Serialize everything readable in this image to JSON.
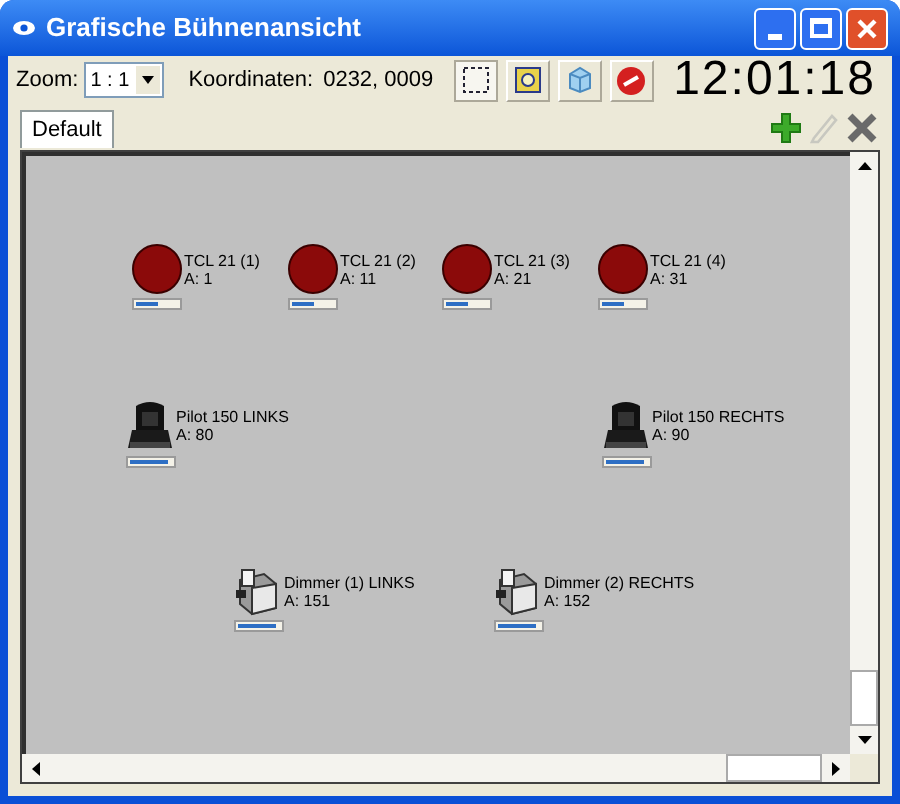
{
  "window": {
    "title": "Grafische Bühnenansicht"
  },
  "toolbar": {
    "zoom_label": "Zoom:",
    "zoom_value": "1 : 1",
    "coords_label": "Koordinaten:",
    "coords_value": "0232, 0009",
    "clock": "12:01:18",
    "tools": [
      {
        "kind": "select",
        "selected": true
      },
      {
        "kind": "frame",
        "selected": false
      },
      {
        "kind": "cube",
        "selected": false
      },
      {
        "kind": "stop",
        "selected": false
      }
    ]
  },
  "tabs": [
    {
      "label": "Default",
      "selected": true
    }
  ],
  "tab_actions": [
    {
      "kind": "add",
      "disabled": false
    },
    {
      "kind": "edit",
      "disabled": true
    },
    {
      "kind": "delete",
      "disabled": false
    }
  ],
  "fixtures": [
    {
      "kind": "par",
      "name": "TCL 21 (1)",
      "address": "A: 1",
      "level": 0.5
    },
    {
      "kind": "par",
      "name": "TCL 21 (2)",
      "address": "A: 11",
      "level": 0.5
    },
    {
      "kind": "par",
      "name": "TCL 21 (3)",
      "address": "A: 21",
      "level": 0.5
    },
    {
      "kind": "par",
      "name": "TCL 21 (4)",
      "address": "A: 31",
      "level": 0.5
    },
    {
      "kind": "moving_head",
      "name": "Pilot 150 LINKS",
      "address": "A: 80",
      "level": 0.9
    },
    {
      "kind": "moving_head",
      "name": "Pilot 150 RECHTS",
      "address": "A: 90",
      "level": 0.9
    },
    {
      "kind": "dimmer",
      "name": "Dimmer (1) LINKS",
      "address": "A: 151",
      "level": 0.9
    },
    {
      "kind": "dimmer",
      "name": "Dimmer (2) RECHTS",
      "address": "A: 152",
      "level": 0.9
    }
  ]
}
